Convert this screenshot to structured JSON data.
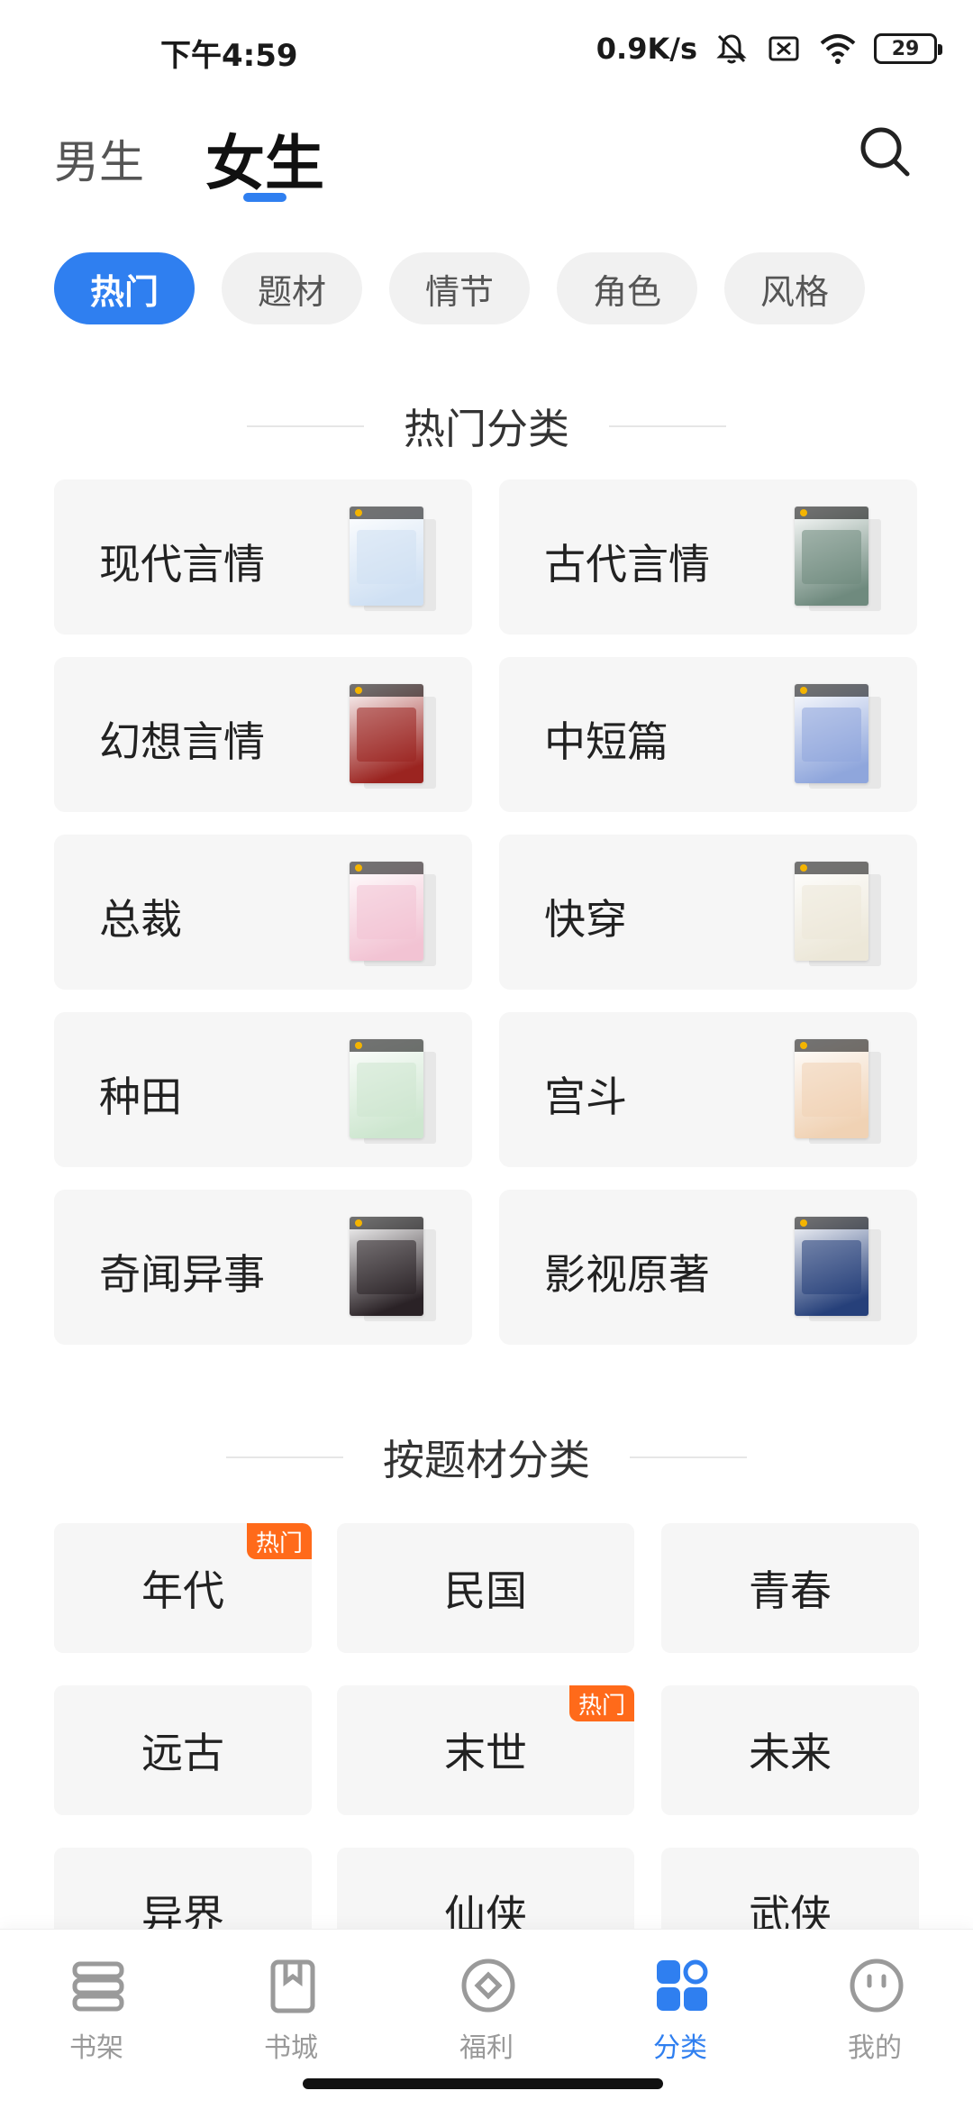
{
  "status_bar": {
    "time": "下午4:59",
    "net_speed": "0.9K/s",
    "battery": "29"
  },
  "header": {
    "tabs": [
      {
        "label": "男生",
        "active": false
      },
      {
        "label": "女生",
        "active": true
      }
    ],
    "search_icon": "search-icon"
  },
  "filters": [
    {
      "label": "热门",
      "active": true
    },
    {
      "label": "题材",
      "active": false
    },
    {
      "label": "情节",
      "active": false
    },
    {
      "label": "角色",
      "active": false
    },
    {
      "label": "风格",
      "active": false
    }
  ],
  "hot_section": {
    "title": "热门分类",
    "categories": [
      {
        "name": "现代言情",
        "cover_color": "#cfe0f3"
      },
      {
        "name": "古代言情",
        "cover_color": "#6f8a7e"
      },
      {
        "name": "幻想言情",
        "cover_color": "#9b2420"
      },
      {
        "name": "中短篇",
        "cover_color": "#8fa6dc"
      },
      {
        "name": "总裁",
        "cover_color": "#f2c3d3"
      },
      {
        "name": "快穿",
        "cover_color": "#ece7d8"
      },
      {
        "name": "种田",
        "cover_color": "#cde6cf"
      },
      {
        "name": "宫斗",
        "cover_color": "#f0d2b4"
      },
      {
        "name": "奇闻异事",
        "cover_color": "#2a2226"
      },
      {
        "name": "影视原著",
        "cover_color": "#26407a"
      }
    ]
  },
  "theme_section": {
    "title": "按题材分类",
    "hot_badge": "热门",
    "tiles": [
      {
        "label": "年代",
        "hot": true
      },
      {
        "label": "民国",
        "hot": false
      },
      {
        "label": "青春",
        "hot": false
      },
      {
        "label": "远古",
        "hot": false
      },
      {
        "label": "末世",
        "hot": true
      },
      {
        "label": "未来",
        "hot": false
      },
      {
        "label": "异界",
        "hot": false
      },
      {
        "label": "仙侠",
        "hot": false
      },
      {
        "label": "武侠",
        "hot": false
      }
    ]
  },
  "bottom_nav": [
    {
      "label": "书架",
      "icon": "bookshelf-icon",
      "active": false
    },
    {
      "label": "书城",
      "icon": "bookstore-icon",
      "active": false
    },
    {
      "label": "福利",
      "icon": "welfare-icon",
      "active": false
    },
    {
      "label": "分类",
      "icon": "category-icon",
      "active": true
    },
    {
      "label": "我的",
      "icon": "profile-icon",
      "active": false
    }
  ],
  "colors": {
    "accent": "#2f7ff0",
    "hot_badge": "#ff6a1a",
    "card_bg": "#f6f6f6",
    "inactive_nav": "#9a9a9a"
  }
}
